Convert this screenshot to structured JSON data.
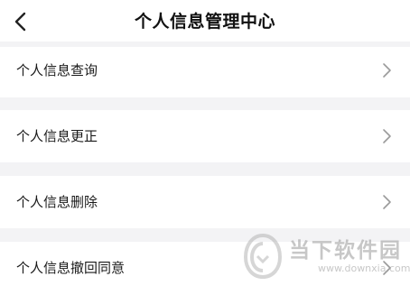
{
  "header": {
    "title": "个人信息管理中心",
    "back_icon": "chevron-left-icon"
  },
  "menu": {
    "items": [
      {
        "label": "个人信息查询",
        "icon": "chevron-right-icon"
      },
      {
        "label": "个人信息更正",
        "icon": "chevron-right-icon"
      },
      {
        "label": "个人信息删除",
        "icon": "chevron-right-icon"
      },
      {
        "label": "个人信息撤回同意",
        "icon": "chevron-right-icon"
      }
    ]
  },
  "watermark": {
    "name": "当下软件园",
    "url": "www.downxia.com"
  },
  "colors": {
    "background": "#f3f3f5",
    "surface": "#ffffff",
    "text": "#1a1a1a",
    "chevron": "#9b9b9b"
  }
}
